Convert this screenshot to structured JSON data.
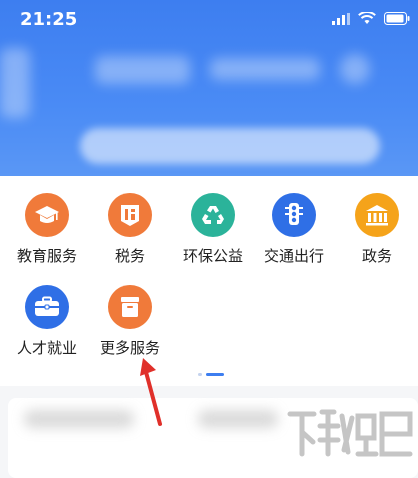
{
  "status_bar": {
    "time": "21:25"
  },
  "services": [
    {
      "label": "教育服务",
      "icon": "graduation-cap-icon",
      "color": "#f07a3a"
    },
    {
      "label": "税务",
      "icon": "tax-seal-icon",
      "color": "#f07a3a"
    },
    {
      "label": "环保公益",
      "icon": "recycle-icon",
      "color": "#2bb39a"
    },
    {
      "label": "交通出行",
      "icon": "traffic-light-icon",
      "color": "#2f6fe6"
    },
    {
      "label": "政务",
      "icon": "government-building-icon",
      "color": "#f5a31a"
    },
    {
      "label": "人才就业",
      "icon": "briefcase-icon",
      "color": "#2f6fe6"
    },
    {
      "label": "更多服务",
      "icon": "more-box-icon",
      "color": "#f07a3a"
    }
  ],
  "colors": {
    "header": "#3d7ef0",
    "accent_arrow": "#e0302a"
  }
}
